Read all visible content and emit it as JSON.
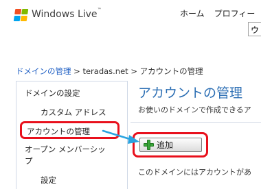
{
  "header": {
    "brand": "Windows Live",
    "trademark": "™",
    "nav": [
      "ホーム",
      "プロフィー"
    ],
    "input_value": "ウ"
  },
  "breadcrumb": {
    "domain_link": "ドメインの管理",
    "sep1": " > ",
    "domain": "teradas.net",
    "sep2": " > ",
    "current": "アカウントの管理"
  },
  "sidebar": {
    "items": [
      {
        "label": "ドメインの設定"
      },
      {
        "label": "カスタム アドレス"
      },
      {
        "label": "アカウントの管理"
      },
      {
        "label": "オープン メンバーシッ\nプ"
      },
      {
        "label": "設定"
      }
    ]
  },
  "main": {
    "title": "アカウントの管理",
    "description": "お使いのドメインで作成できるア",
    "add_button": "追加",
    "message": "このドメインにはアカウントがあ"
  },
  "colors": {
    "highlight": "#e8101c",
    "title": "#2d6fb4",
    "link": "#1f5fc4",
    "arrow": "#29a3e0"
  }
}
